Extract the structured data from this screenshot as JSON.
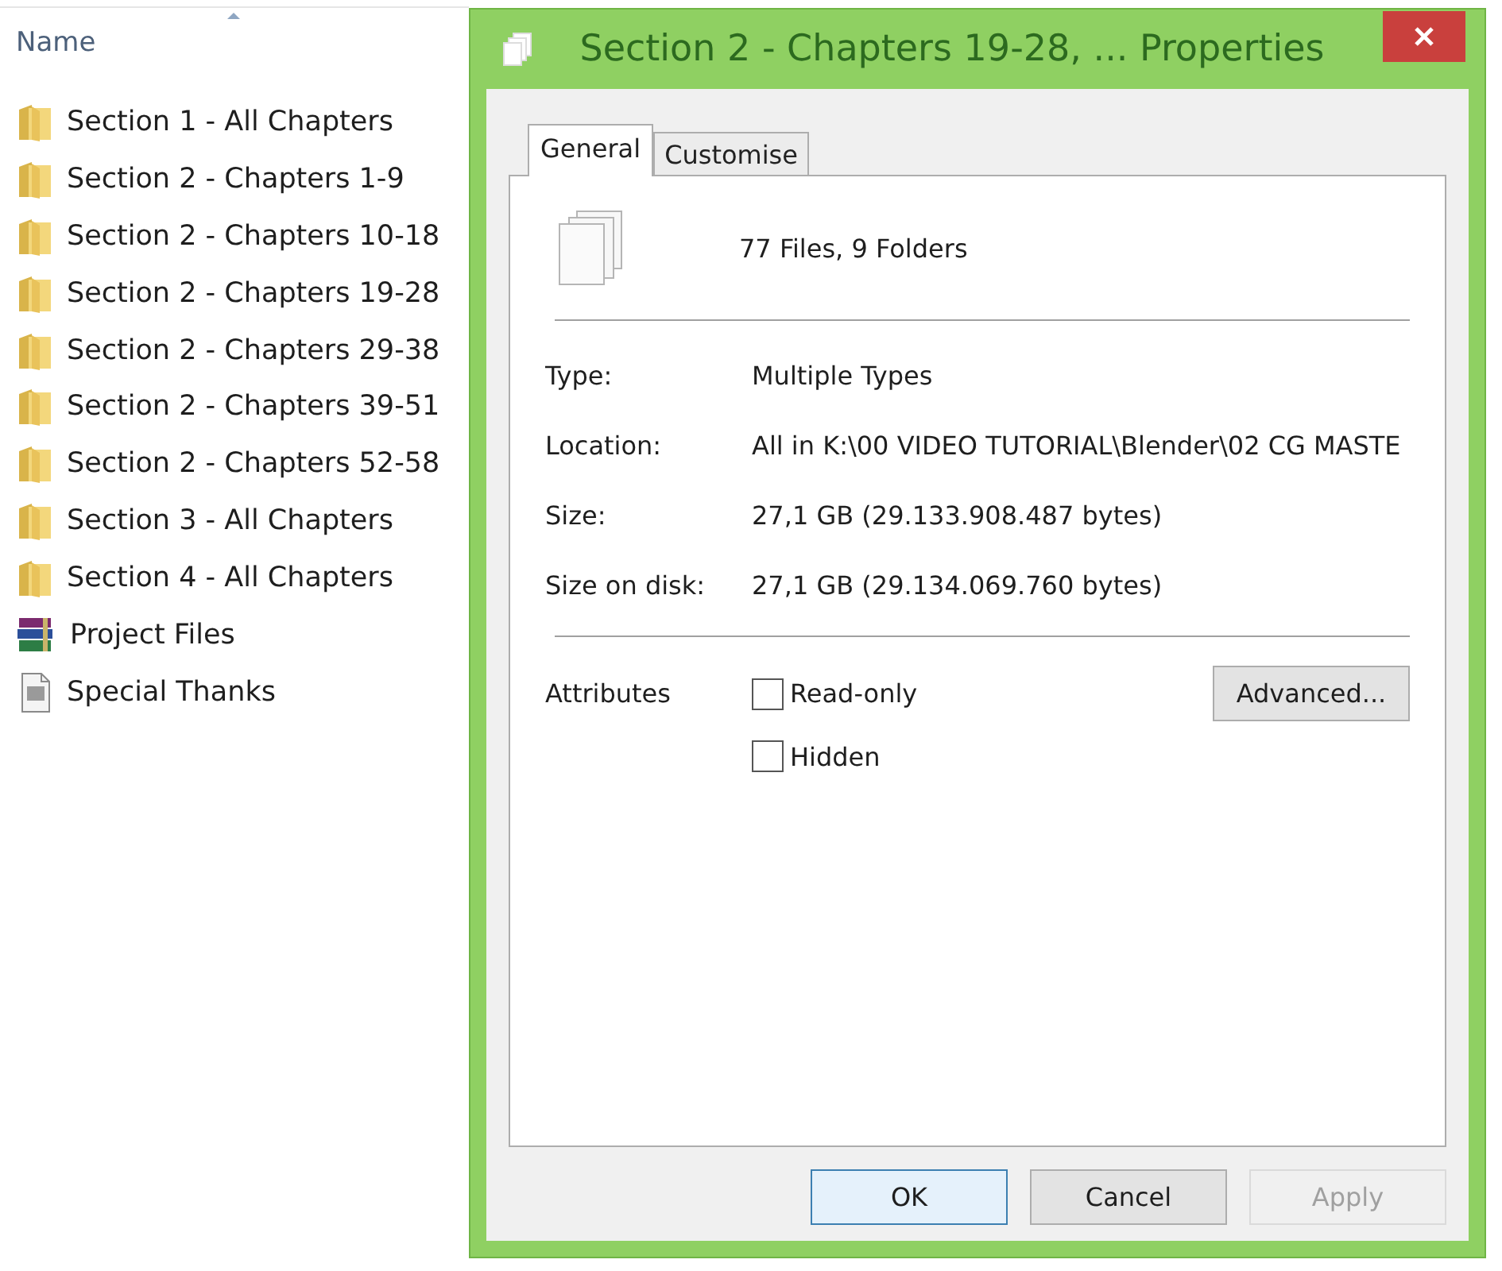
{
  "explorer": {
    "column_header": "Name",
    "items": [
      {
        "kind": "folder",
        "name": "Section 1 - All Chapters"
      },
      {
        "kind": "folder",
        "name": "Section 2 - Chapters 1-9"
      },
      {
        "kind": "folder",
        "name": "Section 2 - Chapters 10-18"
      },
      {
        "kind": "folder",
        "name": "Section 2 - Chapters 19-28"
      },
      {
        "kind": "folder",
        "name": "Section 2 - Chapters 29-38"
      },
      {
        "kind": "folder",
        "name": "Section 2 - Chapters 39-51"
      },
      {
        "kind": "folder",
        "name": "Section 2 - Chapters 52-58"
      },
      {
        "kind": "folder",
        "name": "Section 3 - All Chapters"
      },
      {
        "kind": "folder",
        "name": "Section 4 - All Chapters"
      },
      {
        "kind": "archive",
        "name": "Project Files"
      },
      {
        "kind": "document",
        "name": "Special Thanks"
      }
    ]
  },
  "window": {
    "title": "Section 2 - Chapters 19-28, ... Properties"
  },
  "tabs": [
    {
      "label": "General",
      "selected": true
    },
    {
      "label": "Customise",
      "selected": false
    }
  ],
  "summary": "77 Files, 9 Folders",
  "properties": [
    {
      "label": "Type:",
      "value": "Multiple Types"
    },
    {
      "label": "Location:",
      "value": "All in K:\\00 VIDEO TUTORIAL\\Blender\\02 CG MASTE"
    },
    {
      "label": "Size:",
      "value": "27,1 GB (29.133.908.487 bytes)"
    },
    {
      "label": "Size on disk:",
      "value": "27,1 GB (29.134.069.760 bytes)"
    }
  ],
  "attributes": {
    "label": "Attributes",
    "checkboxes": [
      {
        "label": "Read-only",
        "checked": false
      },
      {
        "label": "Hidden",
        "checked": false
      }
    ],
    "advanced_button": "Advanced..."
  },
  "buttons": [
    {
      "label": "OK",
      "default": true,
      "disabled": false
    },
    {
      "label": "Cancel",
      "default": false,
      "disabled": false
    },
    {
      "label": "Apply",
      "default": false,
      "disabled": true
    }
  ]
}
